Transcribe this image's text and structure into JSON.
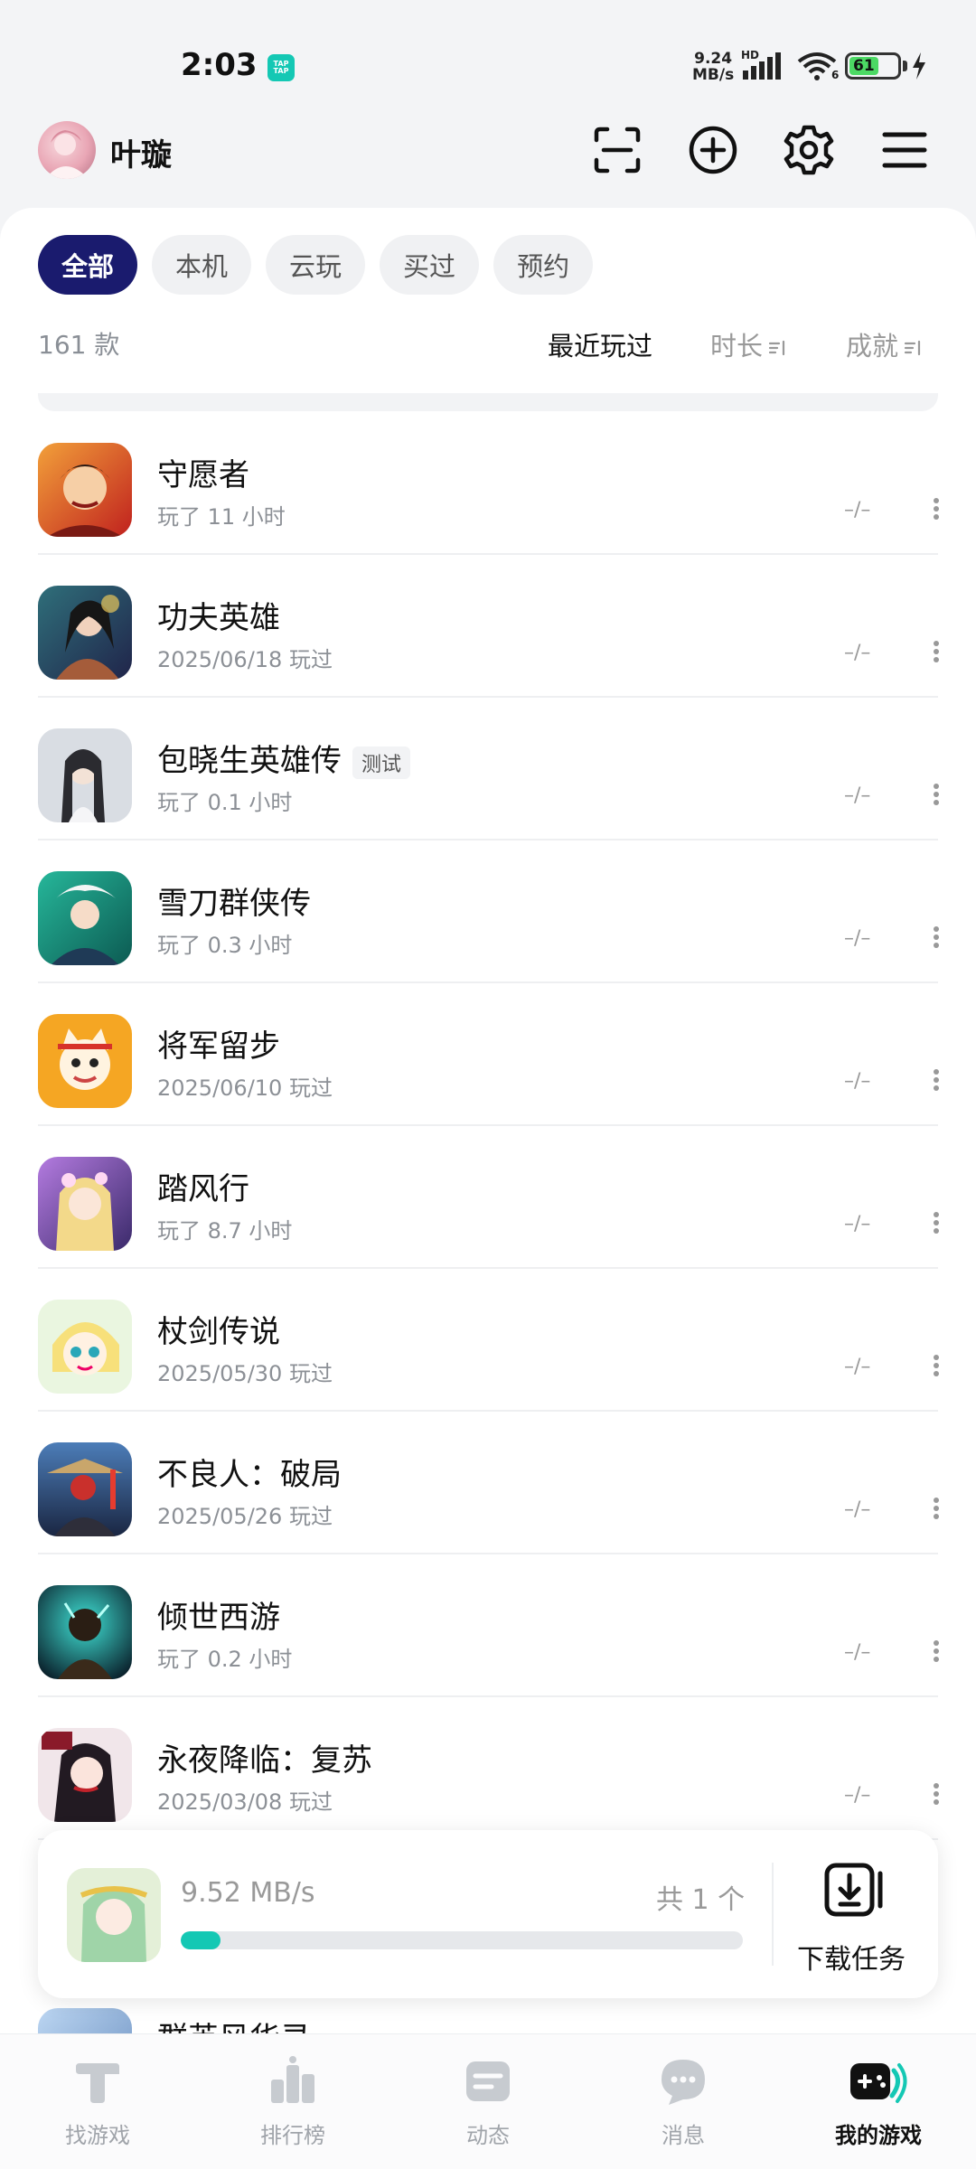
{
  "status_bar": {
    "time": "2:03",
    "app_badge": "TAP TAP",
    "net_speed_value": "9.24",
    "net_speed_unit": "MB/s",
    "network_label": "HD",
    "wifi_label": "6",
    "battery_level": "61"
  },
  "header": {
    "username": "叶璇",
    "icons": [
      "scan-icon",
      "add-circle-icon",
      "gear-icon",
      "menu-icon"
    ]
  },
  "filters": {
    "items": [
      {
        "label": "全部",
        "active": true
      },
      {
        "label": "本机",
        "active": false
      },
      {
        "label": "云玩",
        "active": false
      },
      {
        "label": "买过",
        "active": false
      },
      {
        "label": "预约",
        "active": false
      }
    ]
  },
  "list_meta": {
    "count": "161 款",
    "sort_recent": "最近玩过",
    "sort_duration": "时长",
    "sort_achievement": "成就"
  },
  "games": [
    {
      "title": "守愿者",
      "subtitle": "玩了 11 小时",
      "achievement": "–/–",
      "badge": ""
    },
    {
      "title": "功夫英雄",
      "subtitle": "2025/06/18 玩过",
      "achievement": "–/–",
      "badge": ""
    },
    {
      "title": "包晓生英雄传",
      "subtitle": "玩了 0.1 小时",
      "achievement": "–/–",
      "badge": "测试"
    },
    {
      "title": "雪刀群侠传",
      "subtitle": "玩了 0.3 小时",
      "achievement": "–/–",
      "badge": ""
    },
    {
      "title": "将军留步",
      "subtitle": "2025/06/10 玩过",
      "achievement": "–/–",
      "badge": ""
    },
    {
      "title": "踏风行",
      "subtitle": "玩了 8.7 小时",
      "achievement": "–/–",
      "badge": ""
    },
    {
      "title": "杖剑传说",
      "subtitle": "2025/05/30 玩过",
      "achievement": "–/–",
      "badge": ""
    },
    {
      "title": "不良人：破局",
      "subtitle": "2025/05/26 玩过",
      "achievement": "–/–",
      "badge": ""
    },
    {
      "title": "倾世西游",
      "subtitle": "玩了 0.2 小时",
      "achievement": "–/–",
      "badge": ""
    },
    {
      "title": "永夜降临：复苏",
      "subtitle": "2025/03/08 玩过",
      "achievement": "–/–",
      "badge": ""
    }
  ],
  "download": {
    "speed": "9.52 MB/s",
    "total": "共 1 个",
    "progress_percent": 7,
    "task_label": "下载任务"
  },
  "peek_title": "群英风华录",
  "bottom_nav": {
    "items": [
      {
        "label": "找游戏",
        "icon": "find-game-icon",
        "active": false
      },
      {
        "label": "排行榜",
        "icon": "ranking-icon",
        "active": false
      },
      {
        "label": "动态",
        "icon": "feed-icon",
        "active": false
      },
      {
        "label": "消息",
        "icon": "message-icon",
        "active": false
      },
      {
        "label": "我的游戏",
        "icon": "my-games-icon",
        "active": true
      }
    ]
  },
  "colors": {
    "accent": "#14c8b4",
    "active_chip": "#1a1b6e",
    "battery": "#4cd964"
  }
}
